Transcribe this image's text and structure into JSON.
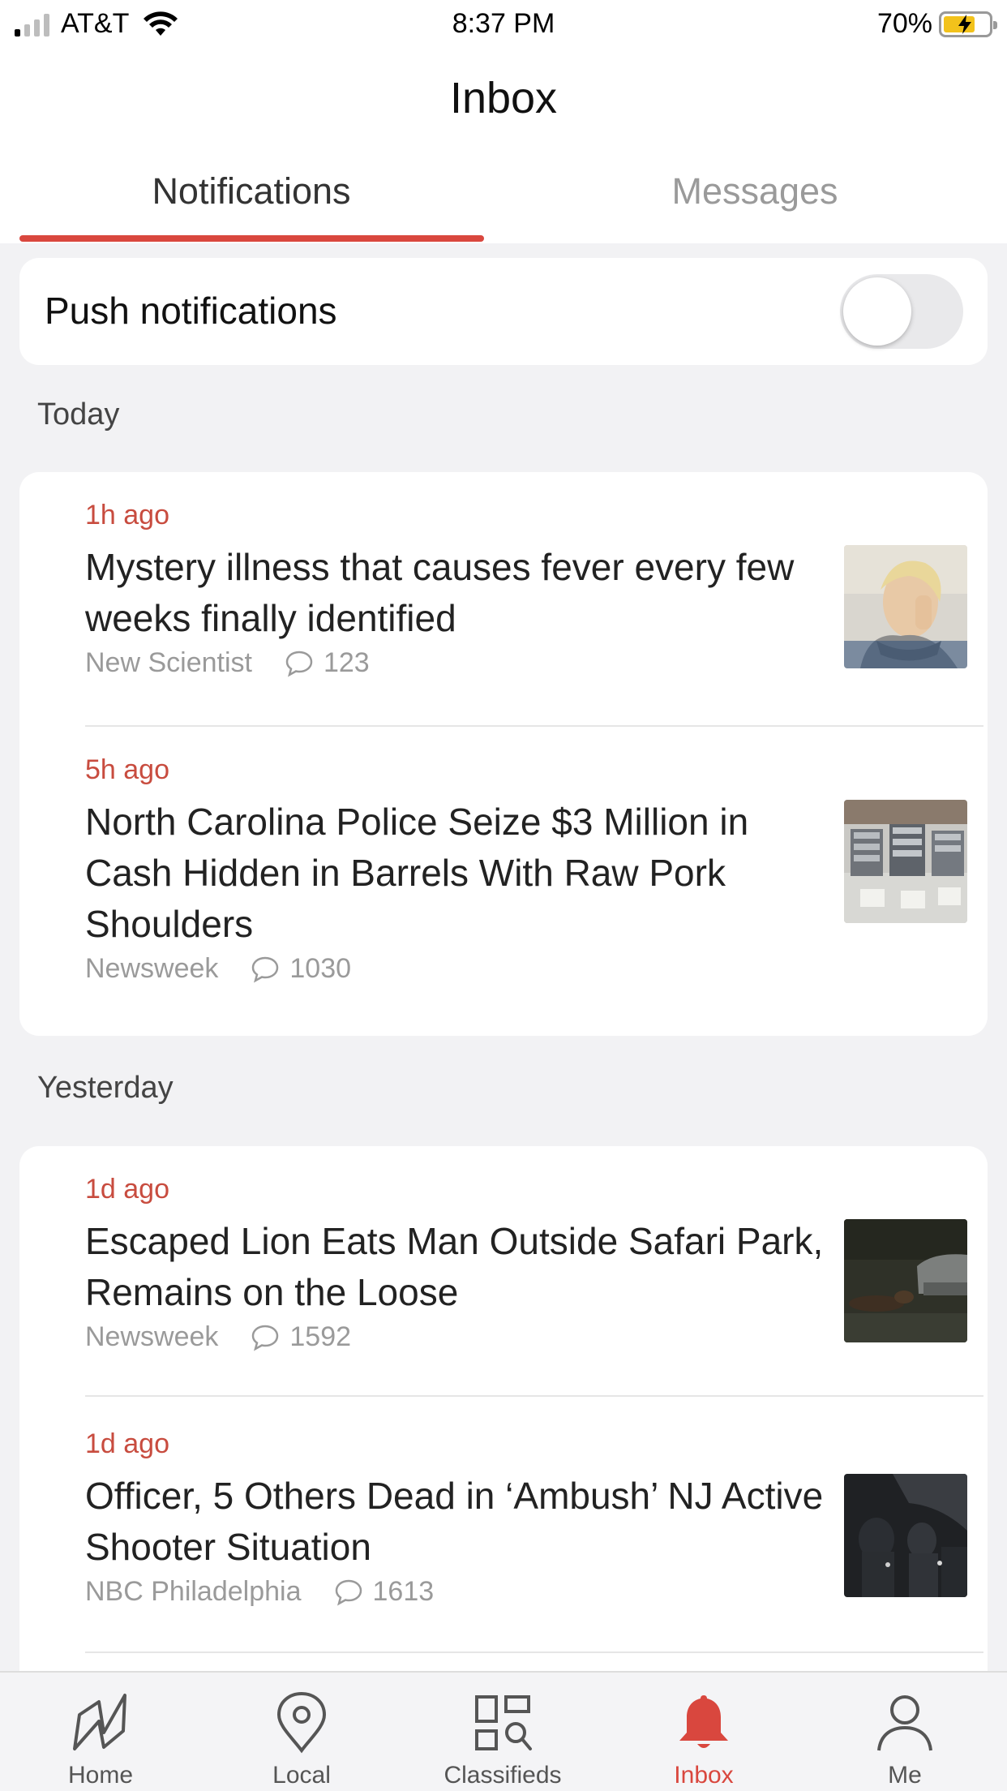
{
  "status_bar": {
    "carrier": "AT&T",
    "time": "8:37 PM",
    "battery_percent": "70%",
    "battery_level": 0.7,
    "signal_bars": 1
  },
  "header": {
    "title": "Inbox",
    "tabs": [
      {
        "label": "Notifications",
        "active": true
      },
      {
        "label": "Messages",
        "active": false
      }
    ]
  },
  "push": {
    "label": "Push notifications",
    "enabled": false
  },
  "sections": [
    {
      "label": "Today",
      "items": [
        {
          "time": "1h ago",
          "title": "Mystery illness that causes fever every few weeks finally identified",
          "source": "New Scientist",
          "comments": "123"
        },
        {
          "time": "5h ago",
          "title": "North Carolina Police Seize $3 Million in Cash Hidden in Barrels With Raw Pork Shoulders",
          "source": "Newsweek",
          "comments": "1030"
        }
      ]
    },
    {
      "label": "Yesterday",
      "items": [
        {
          "time": "1d ago",
          "title": "Escaped Lion Eats Man Outside Safari Park, Remains on the Loose",
          "source": "Newsweek",
          "comments": "1592"
        },
        {
          "time": "1d ago",
          "title": "Officer, 5 Others Dead in ‘Ambush’ NJ Active Shooter Situation",
          "source": "NBC Philadelphia",
          "comments": "1613"
        }
      ]
    }
  ],
  "bottom_nav": [
    {
      "label": "Home",
      "icon": "map-icon",
      "active": false
    },
    {
      "label": "Local",
      "icon": "location-pin-icon",
      "active": false
    },
    {
      "label": "Classifieds",
      "icon": "classifieds-search-icon",
      "active": false
    },
    {
      "label": "Inbox",
      "icon": "bell-icon",
      "active": true
    },
    {
      "label": "Me",
      "icon": "person-icon",
      "active": false
    }
  ],
  "colors": {
    "accent": "#d9473e",
    "time_text": "#c84c3f",
    "meta_text": "#9a9a9a"
  }
}
